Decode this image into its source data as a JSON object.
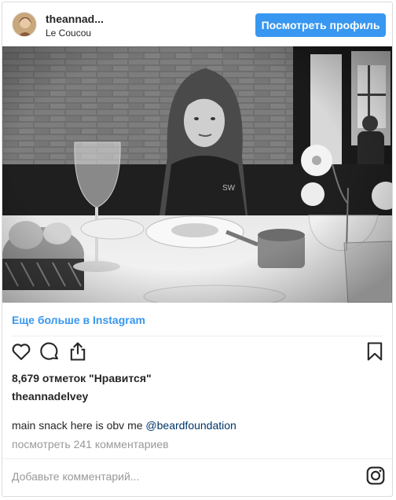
{
  "header": {
    "username": "theannad...",
    "location": "Le Coucou",
    "view_profile_label": "Посмотреть профиль"
  },
  "post": {
    "photo_alt": "",
    "more_link": "Еще больше в Instagram",
    "likes": "8,679 отметок \"Нравится\"",
    "author": "theannadelvey",
    "caption_text": "main snack here is obv me ",
    "caption_mention": "@beardfoundation",
    "comments_link": "посмотреть 241 комментариев",
    "comment_placeholder": "Добавьте комментарий..."
  },
  "icons": {
    "like": "heart-icon",
    "comment": "comment-icon",
    "share": "share-icon",
    "save": "bookmark-icon",
    "instagram": "instagram-icon"
  },
  "colors": {
    "accent": "#3897f0",
    "mention": "#003569",
    "muted": "#999999",
    "text": "#262626"
  }
}
